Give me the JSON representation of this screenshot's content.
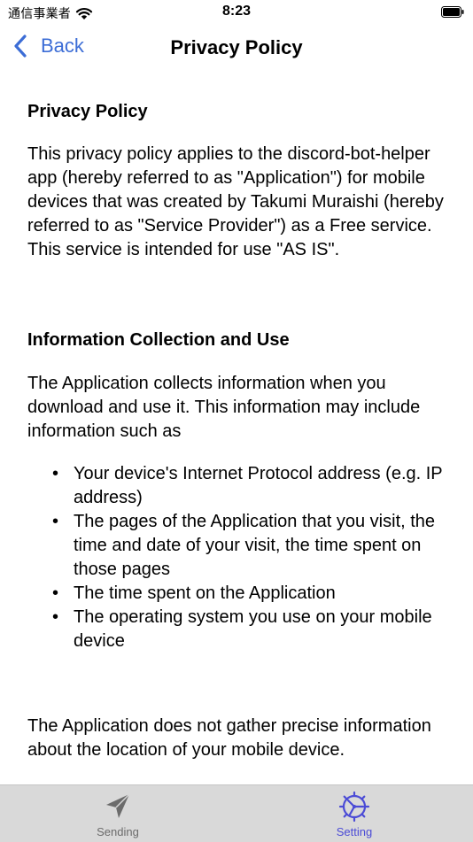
{
  "status_bar": {
    "carrier": "通信事業者",
    "time": "8:23"
  },
  "nav": {
    "back_label": "Back",
    "title": "Privacy Policy"
  },
  "content": {
    "heading_1": "Privacy Policy",
    "intro": "This privacy policy applies to the discord-bot-helper app (hereby referred to as \"Application\") for mobile devices that was created by Takumi Muraishi (hereby referred to as \"Service Provider\") as a Free service. This service is intended for use \"AS IS\".",
    "heading_2": "Information Collection and Use",
    "collect": "The Application collects information when you download and use it. This information may include information such as",
    "bullets": [
      "Your device's Internet Protocol address (e.g. IP address)",
      "The pages of the Application that you visit, the time and date of your visit, the time spent on those pages",
      "The time spent on the Application",
      "The operating system you use on your mobile device"
    ],
    "location": "The Application does not gather precise information about the location of your mobile device."
  },
  "tabs": [
    {
      "label": "Sending",
      "icon": "paper-plane-icon",
      "selected": false
    },
    {
      "label": "Setting",
      "icon": "gear-icon",
      "selected": true
    }
  ],
  "colors": {
    "accent": "#3c6dd6",
    "tab_selected": "#4b4bd6",
    "tab_unselected": "#6b6b6b",
    "tab_bar_bg": "#d9d9d9"
  }
}
